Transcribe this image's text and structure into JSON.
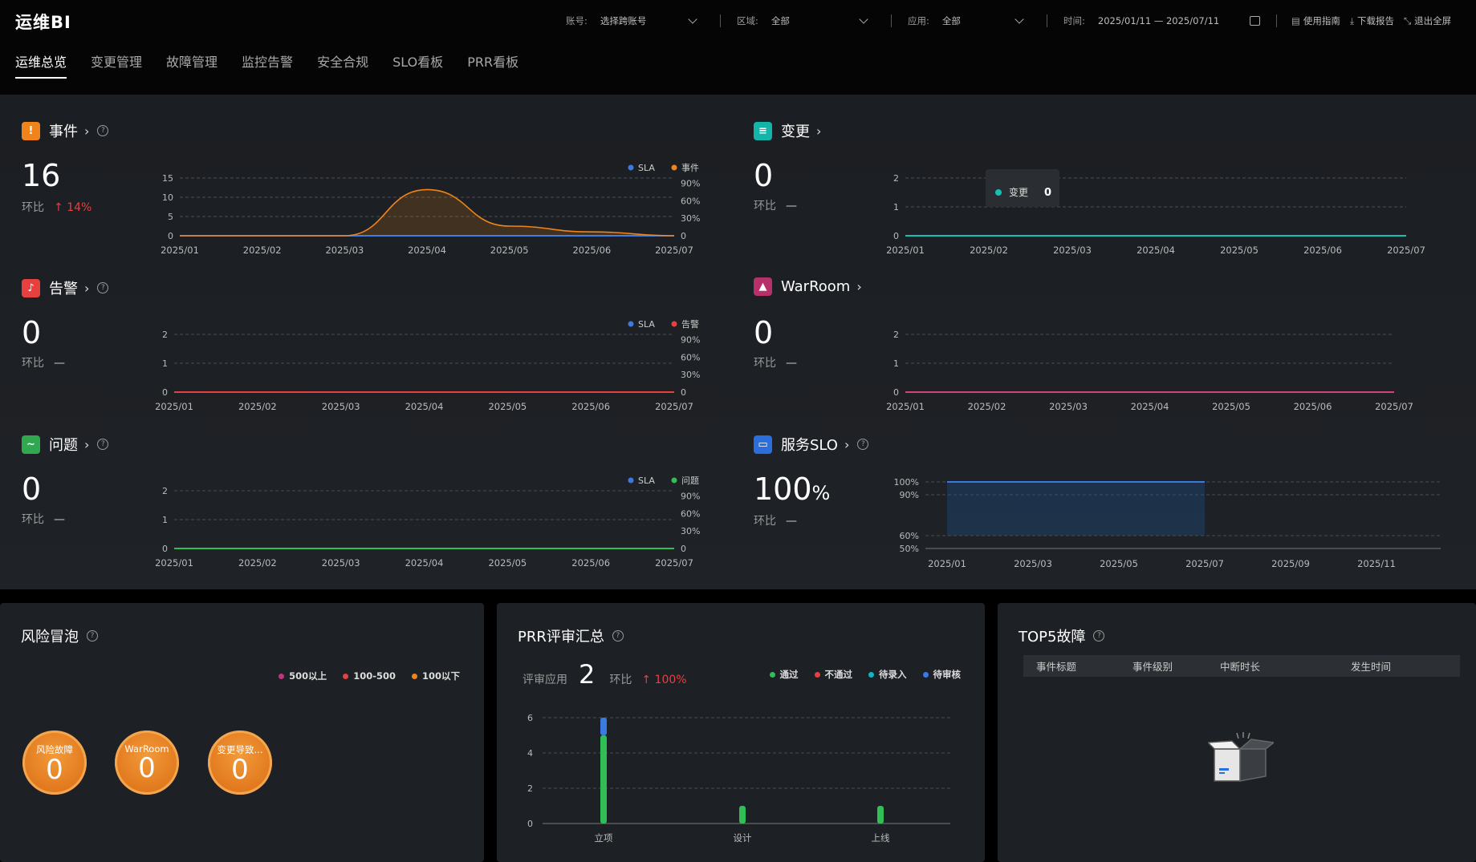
{
  "app": {
    "title": "运维BI"
  },
  "filters": {
    "account": {
      "label": "账号:",
      "value": "选择跨账号"
    },
    "region": {
      "label": "区域:",
      "value": "全部"
    },
    "app": {
      "label": "应用:",
      "value": "全部"
    },
    "time": {
      "label": "时间:",
      "value": "2025/01/11 — 2025/07/11"
    }
  },
  "tools": {
    "guide": "使用指南",
    "download": "下载报告",
    "exit_fullscreen": "退出全屏"
  },
  "tabs": [
    "运维总览",
    "变更管理",
    "故障管理",
    "监控告警",
    "安全合规",
    "SLO看板",
    "PRR看板"
  ],
  "colors": {
    "sla": "#3b7be0",
    "incident": "#f0831a",
    "alarm": "#e8403f",
    "problem": "#2fbf55",
    "change": "#13c2b4",
    "warroom": "#d0457a"
  },
  "cards": {
    "incident": {
      "title": "事件",
      "value": "16",
      "ratio_label": "环比",
      "ratio_value": "14%",
      "icon": "warning-icon"
    },
    "change": {
      "title": "变更",
      "value": "0",
      "ratio_label": "环比",
      "ratio_value": "—",
      "icon": "change-icon"
    },
    "alarm": {
      "title": "告警",
      "value": "0",
      "ratio_label": "环比",
      "ratio_value": "—",
      "icon": "bell-icon"
    },
    "warroom": {
      "title": "WarRoom",
      "value": "0",
      "ratio_label": "环比",
      "ratio_value": "—",
      "icon": "siren-icon"
    },
    "problem": {
      "title": "问题",
      "value": "0",
      "ratio_label": "环比",
      "ratio_value": "—",
      "icon": "chat-icon"
    },
    "slo": {
      "title": "服务SLO",
      "value": "100",
      "unit": "%",
      "ratio_label": "环比",
      "ratio_value": "—",
      "icon": "monitor-icon"
    }
  },
  "chart_data": [
    {
      "id": "incident",
      "type": "area",
      "x": [
        "2025/01",
        "2025/02",
        "2025/03",
        "2025/04",
        "2025/05",
        "2025/06",
        "2025/07"
      ],
      "series": [
        {
          "name": "SLA",
          "values": [
            0,
            0,
            0,
            0,
            0,
            0,
            0
          ]
        },
        {
          "name": "事件",
          "values": [
            0,
            0,
            0,
            12,
            2.5,
            1,
            0
          ]
        }
      ],
      "y_ticks": [
        "0",
        "5",
        "10",
        "15"
      ],
      "y2_ticks": [
        "0",
        "30%",
        "60%",
        "90%"
      ],
      "ylim": [
        0,
        15
      ]
    },
    {
      "id": "change",
      "type": "line",
      "x": [
        "2025/01",
        "2025/02",
        "2025/03",
        "2025/04",
        "2025/05",
        "2025/06",
        "2025/07"
      ],
      "series": [
        {
          "name": "变更",
          "values": [
            0,
            0,
            0,
            0,
            0,
            0,
            0
          ]
        }
      ],
      "y_ticks": [
        "0",
        "1",
        "2"
      ],
      "ylim": [
        0,
        2
      ],
      "tooltip": {
        "label": "变更",
        "value": "0"
      }
    },
    {
      "id": "alarm",
      "type": "line",
      "x": [
        "2025/01",
        "2025/02",
        "2025/03",
        "2025/04",
        "2025/05",
        "2025/06",
        "2025/07"
      ],
      "series": [
        {
          "name": "SLA",
          "values": [
            0,
            0,
            0,
            0,
            0,
            0,
            0
          ]
        },
        {
          "name": "告警",
          "values": [
            0,
            0,
            0,
            0,
            0,
            0,
            0
          ]
        }
      ],
      "y_ticks": [
        "0",
        "1",
        "2"
      ],
      "y2_ticks": [
        "0",
        "30%",
        "60%",
        "90%"
      ],
      "ylim": [
        0,
        2
      ]
    },
    {
      "id": "warroom",
      "type": "line",
      "x": [
        "2025/01",
        "2025/02",
        "2025/03",
        "2025/04",
        "2025/05",
        "2025/06",
        "2025/07"
      ],
      "series": [
        {
          "name": "WarRoom",
          "values": [
            0,
            0,
            0,
            0,
            0,
            0,
            0
          ]
        }
      ],
      "y_ticks": [
        "0",
        "1",
        "2"
      ],
      "ylim": [
        0,
        2
      ]
    },
    {
      "id": "problem",
      "type": "line",
      "x": [
        "2025/01",
        "2025/02",
        "2025/03",
        "2025/04",
        "2025/05",
        "2025/06",
        "2025/07"
      ],
      "series": [
        {
          "name": "SLA",
          "values": [
            0,
            0,
            0,
            0,
            0,
            0,
            0
          ]
        },
        {
          "name": "问题",
          "values": [
            0,
            0,
            0,
            0,
            0,
            0,
            0
          ]
        }
      ],
      "y_ticks": [
        "0",
        "1",
        "2"
      ],
      "y2_ticks": [
        "0",
        "30%",
        "60%",
        "90%"
      ],
      "ylim": [
        0,
        2
      ]
    },
    {
      "id": "slo",
      "type": "area",
      "x": [
        "2025/01",
        "2025/03",
        "2025/05",
        "2025/07",
        "2025/09",
        "2025/11"
      ],
      "series": [
        {
          "name": "SLO",
          "values": [
            100,
            100,
            100,
            100,
            null,
            null
          ]
        }
      ],
      "y_ticks": [
        "50%",
        "60%",
        "90%",
        "100%"
      ],
      "ylim": [
        50,
        100
      ]
    },
    {
      "id": "prr",
      "type": "bar",
      "categories": [
        "立项",
        "设计",
        "上线"
      ],
      "series": [
        {
          "name": "通过",
          "values": [
            5,
            1,
            1
          ]
        },
        {
          "name": "不通过",
          "values": [
            0,
            0,
            0
          ]
        },
        {
          "name": "待录入",
          "values": [
            0,
            0,
            0
          ]
        },
        {
          "name": "待审核",
          "values": [
            1,
            0,
            0
          ]
        }
      ],
      "y_ticks": [
        "0",
        "2",
        "4",
        "6"
      ],
      "ylim": [
        0,
        6
      ]
    }
  ],
  "risk": {
    "title": "风险冒泡",
    "legend": [
      "500以上",
      "100-500",
      "100以下"
    ],
    "legend_colors": [
      "#c2337a",
      "#e8403f",
      "#f0831a"
    ],
    "bubbles": [
      {
        "label": "风险故障",
        "value": "0"
      },
      {
        "label": "WarRoom",
        "value": "0"
      },
      {
        "label": "变更导致...",
        "value": "0"
      }
    ]
  },
  "prr": {
    "title": "PRR评审汇总",
    "apps_label": "评审应用",
    "apps_value": "2",
    "ratio_label": "环比",
    "ratio_value": "100%",
    "legend": [
      "通过",
      "不通过",
      "待录入",
      "待审核"
    ],
    "legend_colors": [
      "#2fbf55",
      "#e8403f",
      "#13b5c2",
      "#3b7be0"
    ]
  },
  "top5": {
    "title": "TOP5故障",
    "columns": [
      "事件标题",
      "事件级别",
      "中断时长",
      "发生时间"
    ]
  }
}
